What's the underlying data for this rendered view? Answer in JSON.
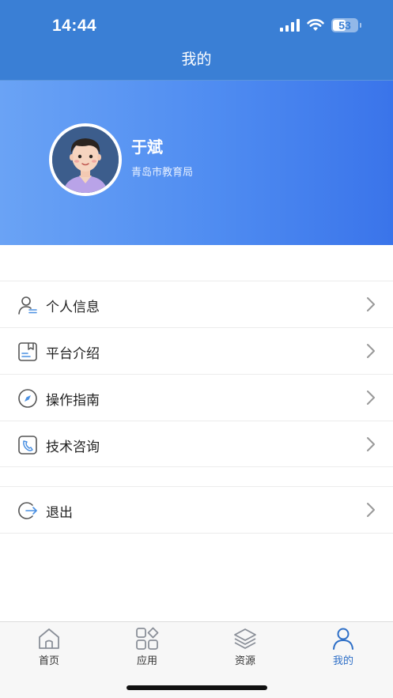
{
  "status_bar": {
    "time": "14:44",
    "battery": "53"
  },
  "header": {
    "title": "我的"
  },
  "profile": {
    "name": "于斌",
    "organization": "青岛市教育局",
    "avatar_icon": "cartoon-avatar"
  },
  "menu": {
    "items": [
      {
        "label": "个人信息",
        "icon": "user-info-icon"
      },
      {
        "label": "平台介绍",
        "icon": "bookmark-doc-icon"
      },
      {
        "label": "操作指南",
        "icon": "compass-icon"
      },
      {
        "label": "技术咨询",
        "icon": "phone-icon"
      }
    ],
    "logout": {
      "label": "退出",
      "icon": "logout-icon"
    }
  },
  "tabbar": {
    "tabs": [
      {
        "label": "首页",
        "icon": "home-icon",
        "active": false
      },
      {
        "label": "应用",
        "icon": "apps-icon",
        "active": false
      },
      {
        "label": "资源",
        "icon": "layers-icon",
        "active": false
      },
      {
        "label": "我的",
        "icon": "person-icon",
        "active": true
      }
    ]
  },
  "colors": {
    "header_bg": "#3a7fd5",
    "profile_gradient_start": "#6aa3f5",
    "profile_gradient_end": "#3a74ea",
    "accent": "#2e6fc7"
  }
}
